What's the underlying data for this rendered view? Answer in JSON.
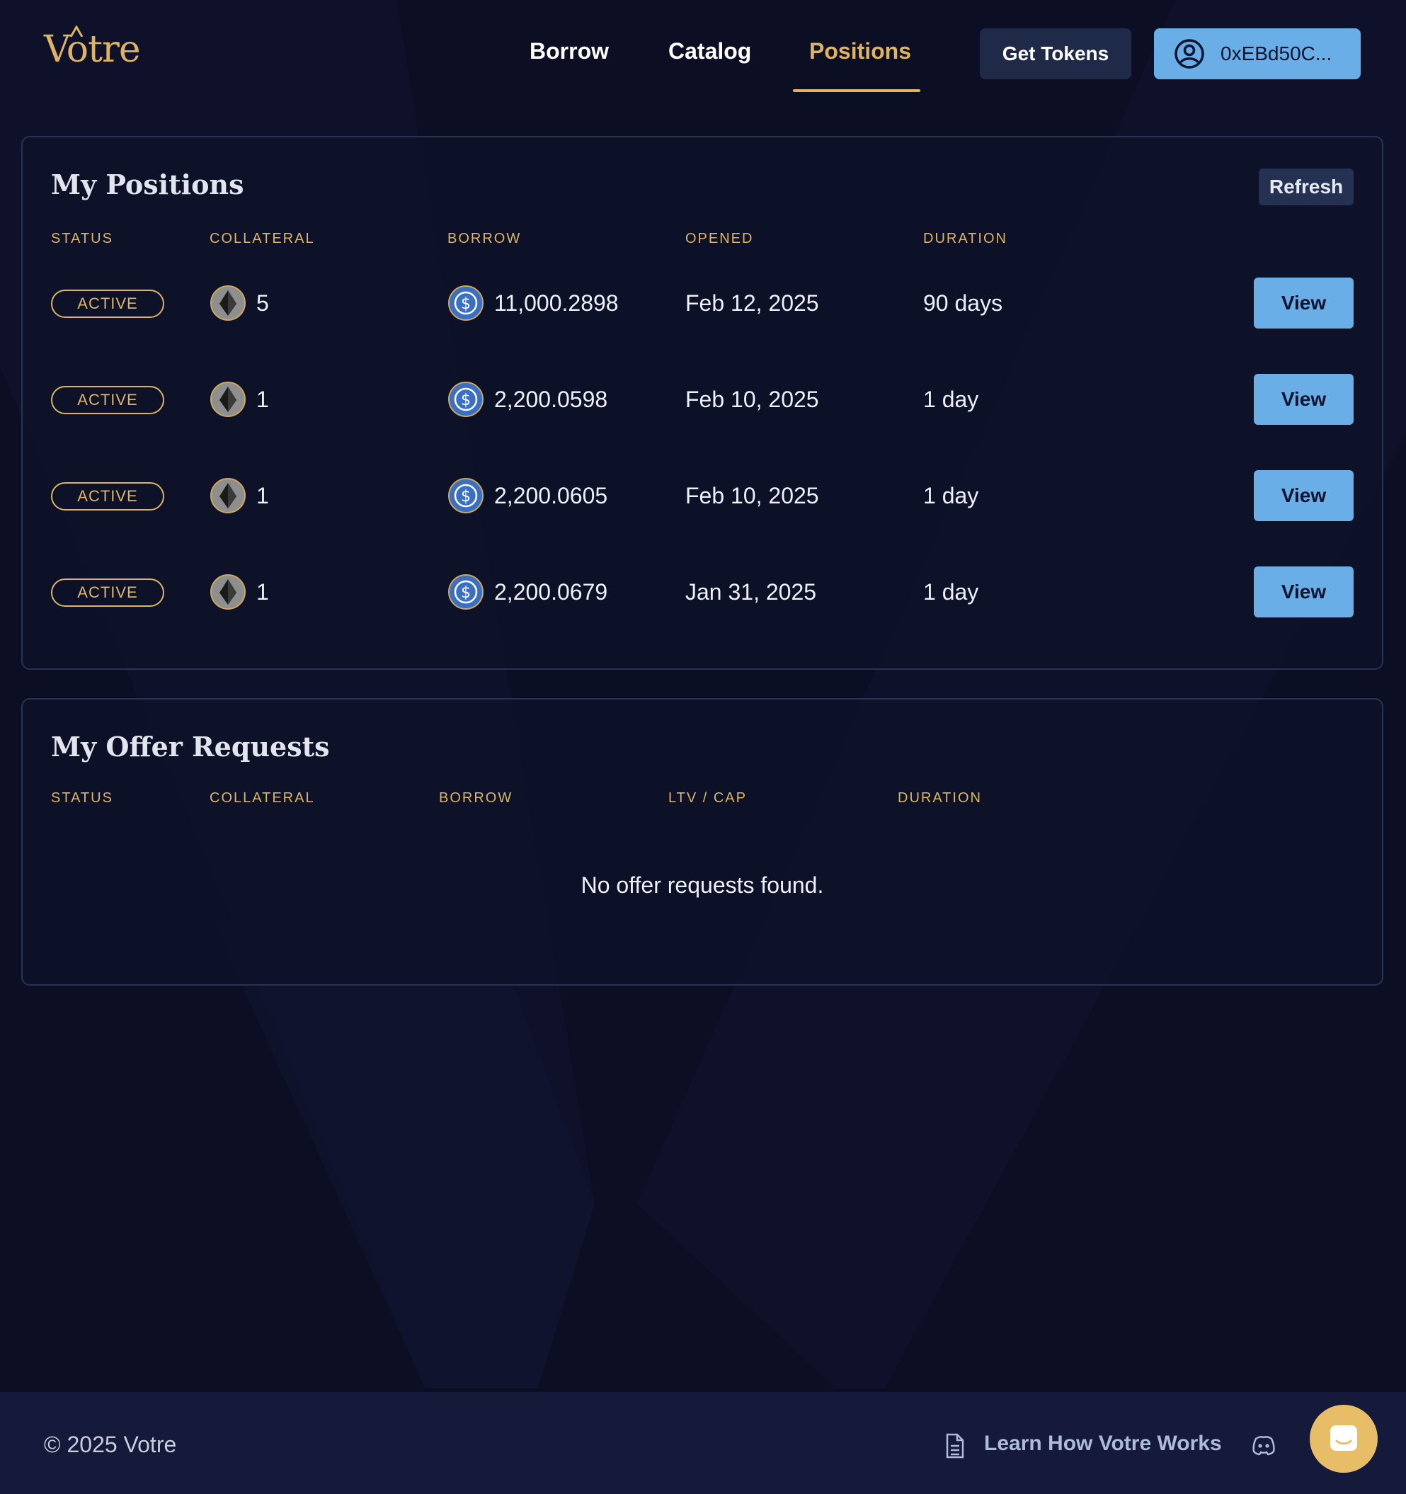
{
  "header": {
    "logo": "Votre",
    "nav": {
      "borrow": "Borrow",
      "catalog": "Catalog",
      "positions": "Positions"
    },
    "get_tokens_label": "Get Tokens",
    "wallet_label": "0xEBd50C...",
    "active_nav": "Positions"
  },
  "positions": {
    "title": "My Positions",
    "refresh_label": "Refresh",
    "columns": {
      "status": "STATUS",
      "collateral": "COLLATERAL",
      "borrow": "BORROW",
      "opened": "OPENED",
      "duration": "DURATION"
    },
    "rows": [
      {
        "status": "ACTIVE",
        "collateral": "5",
        "borrow": "11,000.2898",
        "opened": "Feb 12, 2025",
        "duration": "90 days",
        "action": "View"
      },
      {
        "status": "ACTIVE",
        "collateral": "1",
        "borrow": "2,200.0598",
        "opened": "Feb 10, 2025",
        "duration": "1 day",
        "action": "View"
      },
      {
        "status": "ACTIVE",
        "collateral": "1",
        "borrow": "2,200.0605",
        "opened": "Feb 10, 2025",
        "duration": "1 day",
        "action": "View"
      },
      {
        "status": "ACTIVE",
        "collateral": "1",
        "borrow": "2,200.0679",
        "opened": "Jan 31, 2025",
        "duration": "1 day",
        "action": "View"
      }
    ]
  },
  "offers": {
    "title": "My Offer Requests",
    "columns": {
      "status": "STATUS",
      "collateral": "COLLATERAL",
      "borrow": "BORROW",
      "ltv_cap": "LTV / CAP",
      "duration": "DURATION"
    },
    "empty_message": "No offer requests found."
  },
  "footer": {
    "copyright": "© 2025 Votre",
    "learn_link": "Learn How Votre Works"
  },
  "icons": {
    "collateral_token": "eth-token-icon",
    "borrow_token": "usdc-token-icon",
    "wallet": "user-circle-icon",
    "docs": "document-icon",
    "discord": "discord-icon",
    "chat": "chat-bubble-icon"
  },
  "colors": {
    "background": "#0c0f24",
    "accent_gold": "#dcb463",
    "primary_blue": "#6aaee8",
    "card_border": "#2a3252",
    "footer_bg": "#151a3a"
  }
}
